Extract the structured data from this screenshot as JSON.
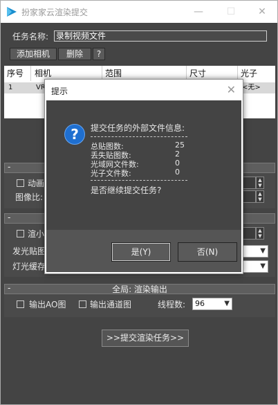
{
  "window": {
    "title": "扮家家云渲染提交",
    "controls": {
      "minimize": "—",
      "maximize": "☐",
      "close": "✕"
    }
  },
  "task": {
    "name_label": "任务名称:",
    "name_value": "录制视频文件"
  },
  "toolbar": {
    "add_camera": "添加相机",
    "delete": "删除",
    "help": "?"
  },
  "table": {
    "headers": [
      "序号",
      "相机",
      "范围",
      "尺寸",
      "光子"
    ],
    "rows": [
      {
        "index": "1",
        "camera": "VR",
        "range": "",
        "size": "",
        "photon": "<无>"
      }
    ]
  },
  "panel_a": {
    "animation_label": "动画",
    "aspect_label": "图像比:"
  },
  "panel_b": {
    "render_label": "渲小",
    "glow_map_label": "发光贴图",
    "light_cache_label": "灯光缓存"
  },
  "global_panel": {
    "title": "全局: 渲染输出",
    "ao_label": "输出AO图",
    "channel_label": "输出通道图",
    "threads_label": "线程数:",
    "threads_value": "96"
  },
  "submit_button": ">>提交渲染任务>>",
  "dialog": {
    "title": "提示",
    "heading": "提交任务的外部文件信息:",
    "dashes": "-------------------------------",
    "stats": [
      {
        "label": "总贴图数:",
        "value": "25"
      },
      {
        "label": "丢失贴图数:",
        "value": "2"
      },
      {
        "label": "光域网文件数:",
        "value": "0"
      },
      {
        "label": "光子文件数:",
        "value": "0"
      }
    ],
    "question": "是否继续提交任务?",
    "yes_button": "是(Y)",
    "no_button": "否(N)"
  },
  "colors": {
    "window_bg": "#444444",
    "accent_icon": "#1f6fd0"
  }
}
